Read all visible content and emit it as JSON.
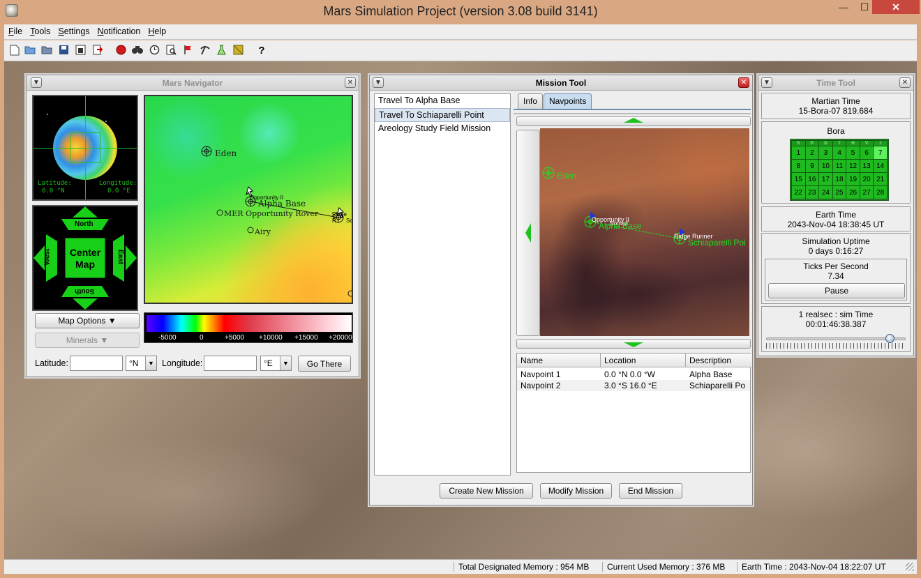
{
  "window": {
    "title": "Mars Simulation Project (version 3.08 build 3141)",
    "minimize_glyph": "—",
    "maximize_glyph": "☐",
    "close_glyph": "✕"
  },
  "menu": [
    "File",
    "Tools",
    "Settings",
    "Notification",
    "Help"
  ],
  "toolbar_icons": [
    "new-file-icon",
    "open-folder-icon",
    "open-autosave-icon",
    "save-icon",
    "save-as-icon",
    "exit-icon",
    "record-icon",
    "binoculars-icon",
    "clock-icon",
    "search-doc-icon",
    "flag-icon",
    "pickaxe-icon",
    "flask-icon",
    "map-icon",
    "help-icon"
  ],
  "toolbar_help_glyph": "?",
  "status": {
    "total_memory": "Total Designated Memory : 954 MB",
    "used_memory": "Current Used Memory : 376 MB",
    "earth_time": "Earth Time : 2043-Nov-04  18:22:07 UT"
  },
  "navigator": {
    "title": "Mars Navigator",
    "latitude_label": "Latitude:",
    "latitude_value": "0.0 °N",
    "longitude_label": "Longitude:",
    "longitude_value": "0.0 °E",
    "compass": {
      "north": "North",
      "south": "South",
      "east": "East",
      "west": "West",
      "center_line1": "Center",
      "center_line2": "Map"
    },
    "map_labels": {
      "eden": "Eden",
      "opportunity": "Opportunity II",
      "alpha_base": "Alpha Base",
      "mer": "MER Opportunity Rover",
      "airy": "Airy",
      "ridge": "Ridge R",
      "schiap": "Sc"
    },
    "map_options": "Map Options ▼",
    "minerals": "Minerals ▼",
    "colorbar_ticks": [
      "-5000",
      "0",
      "+5000",
      "+10000",
      "+15000",
      "+20000"
    ],
    "lat_input_label": "Latitude:",
    "lat_input_value": "",
    "lat_unit": "°N",
    "lon_input_label": "Longitude:",
    "lon_input_value": "",
    "lon_unit": "°E",
    "go_there": "Go There"
  },
  "mission_tool": {
    "title": "Mission Tool",
    "missions": [
      "Travel To Alpha Base",
      "Travel To Schiaparelli Point",
      "Areology Study Field Mission"
    ],
    "selected_mission": 1,
    "tabs": [
      "Info",
      "Navpoints"
    ],
    "selected_tab": 1,
    "map_labels": {
      "eden": "Eden",
      "opportunity": "Opportunity II",
      "nomad": "Nomad",
      "alpha_base": "Alpha Base",
      "ridge": "Ridge Runner",
      "schiap": "Schiaparelli Poi"
    },
    "table": {
      "columns": [
        "Name",
        "Location",
        "Description"
      ],
      "rows": [
        {
          "name": "Navpoint 1",
          "location": "0.0 °N 0.0 °W",
          "description": "Alpha Base"
        },
        {
          "name": "Navpoint 2",
          "location": "3.0 °S 16.0 °E",
          "description": "Schiaparelli Po"
        }
      ]
    },
    "buttons": {
      "create": "Create New Mission",
      "modify": "Modify Mission",
      "end": "End Mission"
    }
  },
  "time_tool": {
    "title": "Time Tool",
    "martian_time_label": "Martian Time",
    "martian_time": "15-Bora-07  819.684",
    "month": "Bora",
    "calendar_days": [
      "1",
      "2",
      "3",
      "4",
      "5",
      "6",
      "7",
      "8",
      "9",
      "10",
      "11",
      "12",
      "13",
      "14",
      "15",
      "16",
      "17",
      "18",
      "19",
      "20",
      "21",
      "22",
      "23",
      "24",
      "25",
      "26",
      "27",
      "28"
    ],
    "today": "7",
    "weekday_heads": [
      "S",
      "P",
      "D",
      "T",
      "H",
      "V",
      "J"
    ],
    "earth_time_label": "Earth Time",
    "earth_time": "2043-Nov-04  18:38:45 UT",
    "uptime_label": "Simulation Uptime",
    "uptime": "0 days 0:16:27",
    "tps_label": "Ticks Per Second",
    "tps": "7.34",
    "pause": "Pause",
    "ratio_label": "1 realsec : sim Time",
    "ratio": "00:01:46:38.387"
  }
}
